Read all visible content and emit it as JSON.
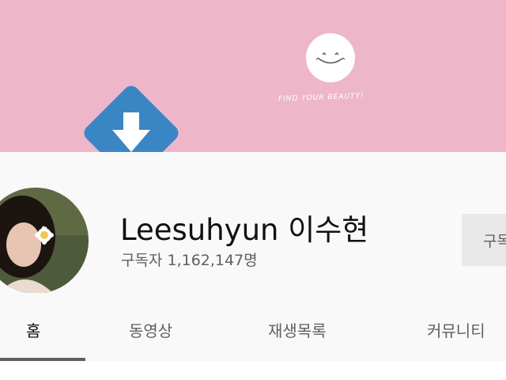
{
  "banner": {
    "tagline": "FIND YOUR BEAUTY!",
    "background_color": "#eeb6c9",
    "logo_icon": "smiley-face-icon",
    "overlay_icon": "down-arrow-icon",
    "overlay_color": "#3a86c4"
  },
  "channel": {
    "name": "Leesuhyun 이수현",
    "subscribers": "구독자 1,162,147명",
    "subscribe_label": "구독",
    "avatar": "channel-avatar"
  },
  "tabs": [
    {
      "label": "홈",
      "active": true
    },
    {
      "label": "동영상",
      "active": false
    },
    {
      "label": "재생목록",
      "active": false
    },
    {
      "label": "커뮤니티",
      "active": false
    }
  ]
}
